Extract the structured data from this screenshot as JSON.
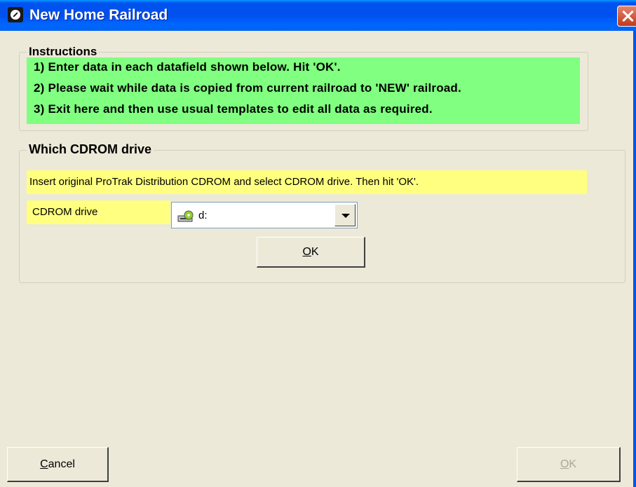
{
  "window": {
    "title": "New Home Railroad"
  },
  "instructions": {
    "legend": "Instructions",
    "lines": [
      "1)  Enter data in each datafield shown below.    Hit 'OK'.",
      "2)  Please wait while data is copied from current railroad to 'NEW' railroad.",
      "3)  Exit here and then use usual templates to edit all data as required."
    ],
    "background_color": "#80FF80"
  },
  "cdrom": {
    "legend": "Which CDROM drive",
    "hint": "Insert original ProTrak Distribution CDROM and select CDROM drive.  Then hit 'OK'.",
    "drive_label": "CDROM drive",
    "drive_value": "d:",
    "ok_label_mnemonic": "O",
    "ok_label_rest": "K",
    "highlight_color": "#FFFF80"
  },
  "footer": {
    "cancel_mnemonic": "C",
    "cancel_rest": "ancel",
    "ok_mnemonic": "O",
    "ok_rest": "K",
    "ok_enabled": false
  },
  "icons": [
    "app-railroad-icon",
    "close-icon",
    "cd-drive-icon",
    "dropdown-arrow-icon"
  ]
}
